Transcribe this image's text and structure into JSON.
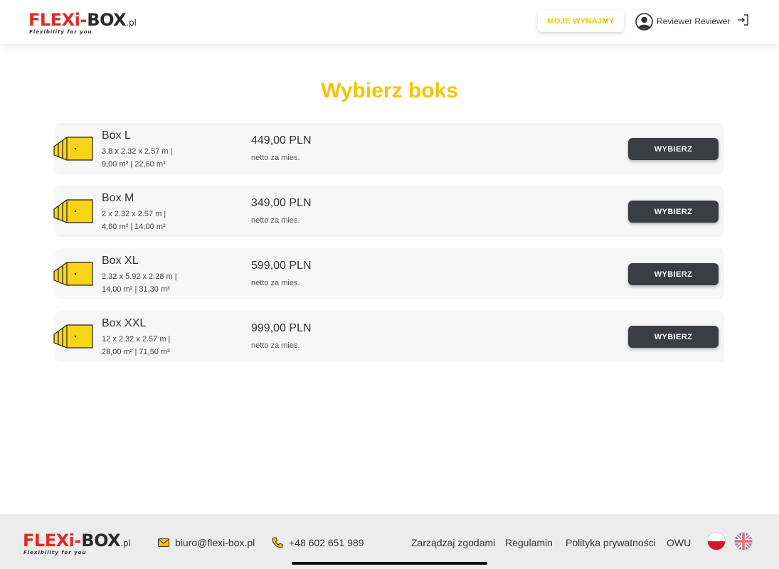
{
  "header": {
    "logo": {
      "flexi": "FLEXi",
      "dash": "-",
      "box": "BOX",
      "pl": ".pl",
      "tagline": "Flexibility for you"
    },
    "rentals_button": "MOJE WYNAJMY",
    "user_name": "Reviewer Reviewer",
    "icons": {
      "avatar": "user-circle-icon",
      "logout": "logout-icon"
    }
  },
  "main": {
    "title": "Wybierz boks",
    "boxes": [
      {
        "name": "Box L",
        "dims": "3.8 x 2.32 x 2.57 m |",
        "area": "9,00 m² | 22,60 m³",
        "price": "449,00 PLN",
        "price_note": "netto za mies.",
        "button": "WYBIERZ"
      },
      {
        "name": "Box M",
        "dims": "2 x 2.32 x 2.57 m |",
        "area": "4,60 m² | 14,00 m³",
        "price": "349,00 PLN",
        "price_note": "netto za mies.",
        "button": "WYBIERZ"
      },
      {
        "name": "Box XL",
        "dims": "2.32 x 5.92 x 2.28 m |",
        "area": "14,00 m² | 31,30 m³",
        "price": "599,00 PLN",
        "price_note": "netto za mies.",
        "button": "WYBIERZ"
      },
      {
        "name": "Box XXL",
        "dims": "12 x 2.32 x 2.57 m |",
        "area": "28,00 m² | 71,50 m³",
        "price": "999,00 PLN",
        "price_note": "netto za mies.",
        "button": "WYBIERZ"
      }
    ]
  },
  "footer": {
    "email": "biuro@flexi-box.pl",
    "phone": "+48 602 651 989",
    "links": [
      "Zarządzaj zgodami",
      "Regulamin",
      "Polityka prywatności",
      "OWU"
    ],
    "languages": [
      "pl-flag-icon",
      "uk-flag-icon"
    ]
  },
  "colors": {
    "accent": "#f5c400",
    "brand_red": "#e02a27",
    "dark_button": "#3a3e42"
  }
}
